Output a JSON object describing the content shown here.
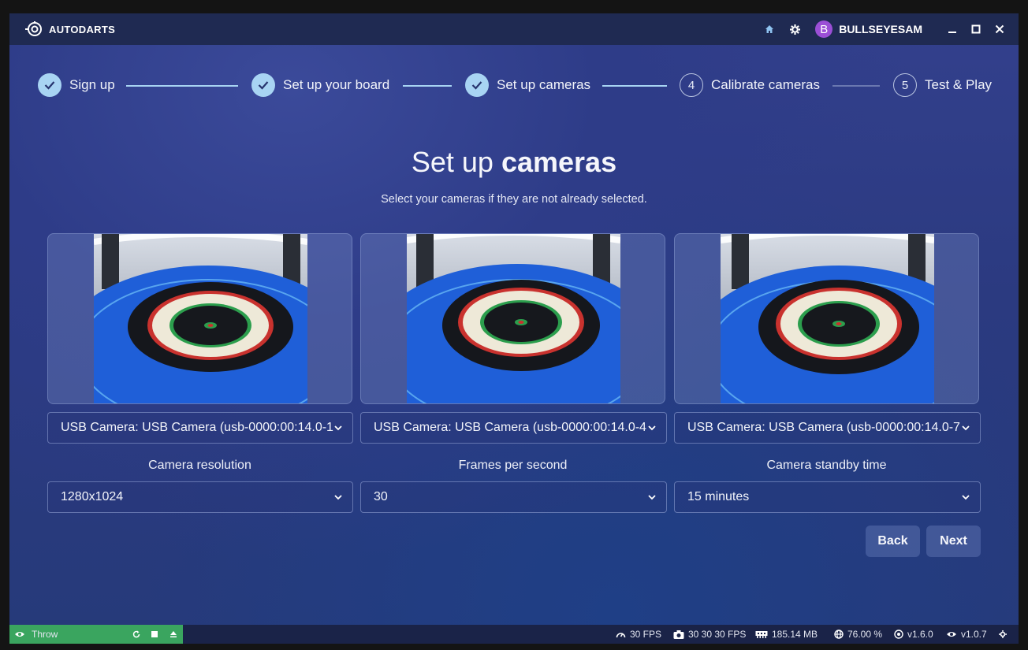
{
  "app": {
    "name": "AUTODARTS"
  },
  "user": {
    "initial": "B",
    "name": "BULLSEYESAM"
  },
  "steps": [
    {
      "number": "1",
      "label": "Sign up",
      "done": true
    },
    {
      "number": "2",
      "label": "Set up your board",
      "done": true
    },
    {
      "number": "3",
      "label": "Set up cameras",
      "done": true
    },
    {
      "number": "4",
      "label": "Calibrate cameras",
      "done": false
    },
    {
      "number": "5",
      "label": "Test & Play",
      "done": false
    }
  ],
  "page": {
    "title_light": "Set up ",
    "title_bold": "cameras",
    "subtitle": "Select your cameras if they are not already selected."
  },
  "cameras": [
    {
      "device": "USB Camera: USB Camera (usb-0000:00:14.0-1"
    },
    {
      "device": "USB Camera: USB Camera (usb-0000:00:14.0-4"
    },
    {
      "device": "USB Camera: USB Camera (usb-0000:00:14.0-7"
    }
  ],
  "settings": {
    "resolution": {
      "label": "Camera resolution",
      "value": "1280x1024"
    },
    "fps": {
      "label": "Frames per second",
      "value": "30"
    },
    "standby": {
      "label": "Camera standby time",
      "value": "15 minutes"
    }
  },
  "buttons": {
    "back": "Back",
    "next": "Next"
  },
  "statusbar": {
    "mode": "Throw",
    "fps": "30 FPS",
    "camera_fps": "30 30 30 FPS",
    "memory": "185.14 MB",
    "cpu": "76.00 %",
    "board_version": "v1.6.0",
    "app_version": "v1.0.7"
  },
  "colors": {
    "accent": "#a8d4f3",
    "throw_green": "#3aa55f",
    "avatar": "#9b4fd6",
    "titlebar": "#1f2a52"
  }
}
